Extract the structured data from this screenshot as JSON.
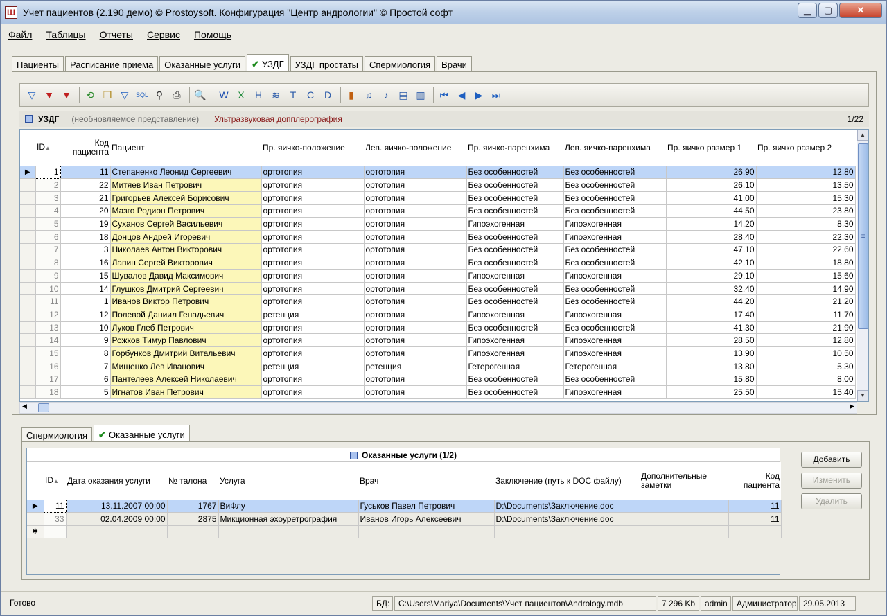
{
  "window": {
    "title": "Учет пациентов (2.190 демо) © Prostoysoft. Конфигурация \"Центр андрологии\" © Простой софт",
    "minimize": "▁",
    "maximize": "▢",
    "close": "✕"
  },
  "menu": [
    "Файл",
    "Таблицы",
    "Отчеты",
    "Сервис",
    "Помощь"
  ],
  "main_tabs": [
    "Пациенты",
    "Расписание приема",
    "Оказанные услуги",
    "УЗДГ",
    "УЗДГ простаты",
    "Спермиология",
    "Врачи"
  ],
  "main_tabs_checked": "✔",
  "toolbar_icons": [
    "filter-icon",
    "filter-add-icon",
    "filter-clear-icon",
    "refresh-icon",
    "copy-icon",
    "filter-edit-icon",
    "sql-icon",
    "find-icon",
    "print-icon",
    "preview-icon",
    "export-word-icon",
    "export-excel-icon",
    "export-html-icon",
    "export-xml-icon",
    "export-text-icon",
    "export-csv-icon",
    "export-dbf-icon",
    "chart-icon",
    "report-icon",
    "report-2-icon",
    "note-icon",
    "note-2-icon",
    "first-record-icon",
    "prev-record-icon",
    "next-record-icon",
    "last-record-icon"
  ],
  "view": {
    "name": "УЗДГ",
    "note": "(необновляемое представление)",
    "description": "Ультразвуковая допплерография",
    "position": "1/22"
  },
  "grid": {
    "columns": [
      "ID",
      "Код пациента",
      "Пациент",
      "Пр. яичко-положение",
      "Лев. яичко-положение",
      "Пр. яичко-паренхима",
      "Лев. яичко-паренхима",
      "Пр. яичко размер 1",
      "Пр. яичко размер 2"
    ],
    "sort_indicator": "▲",
    "current_row_marker": "▶",
    "rows": [
      [
        "1",
        "11",
        "Степаненко Леонид Сергеевич",
        "ортотопия",
        "ортотопия",
        "Без особенностей",
        "Без особенностей",
        "26.90",
        "12.80"
      ],
      [
        "2",
        "22",
        "Митяев Иван Петрович",
        "ортотопия",
        "ортотопия",
        "Без особенностей",
        "Без особенностей",
        "26.10",
        "13.50"
      ],
      [
        "3",
        "21",
        "Григорьев Алексей Борисович",
        "ортотопия",
        "ортотопия",
        "Без особенностей",
        "Без особенностей",
        "41.00",
        "15.30"
      ],
      [
        "4",
        "20",
        "Мазго Родион Петрович",
        "ортотопия",
        "ортотопия",
        "Без особенностей",
        "Без особенностей",
        "44.50",
        "23.80"
      ],
      [
        "5",
        "19",
        "Суханов Сергей Васильевич",
        "ортотопия",
        "ортотопия",
        "Гипоэхогенная",
        "Гипоэхогенная",
        "14.20",
        "8.30"
      ],
      [
        "6",
        "18",
        "Донцов Андрей Игоревич",
        "ортотопия",
        "ортотопия",
        "Без особенностей",
        "Гипоэхогенная",
        "28.40",
        "22.30"
      ],
      [
        "7",
        "3",
        "Николаев Антон Викторович",
        "ортотопия",
        "ортотопия",
        "Без особенностей",
        "Без особенностей",
        "47.10",
        "22.60"
      ],
      [
        "8",
        "16",
        "Лапин Сергей Викторович",
        "ортотопия",
        "ортотопия",
        "Без особенностей",
        "Без особенностей",
        "42.10",
        "18.80"
      ],
      [
        "9",
        "15",
        "Шувалов Давид Максимович",
        "ортотопия",
        "ортотопия",
        "Гипоэхогенная",
        "Гипоэхогенная",
        "29.10",
        "15.60"
      ],
      [
        "10",
        "14",
        "Глушков Дмитрий Сергеевич",
        "ортотопия",
        "ортотопия",
        "Без особенностей",
        "Без особенностей",
        "32.40",
        "14.90"
      ],
      [
        "11",
        "1",
        "Иванов Виктор Петрович",
        "ортотопия",
        "ортотопия",
        "Без особенностей",
        "Без особенностей",
        "44.20",
        "21.20"
      ],
      [
        "12",
        "12",
        "Полевой Даниил Генадьевич",
        "ретенция",
        "ортотопия",
        "Гипоэхогенная",
        "Гипоэхогенная",
        "17.40",
        "11.70"
      ],
      [
        "13",
        "10",
        "Луков Глеб Петрович",
        "ортотопия",
        "ортотопия",
        "Без особенностей",
        "Без особенностей",
        "41.30",
        "21.90"
      ],
      [
        "14",
        "9",
        "Рожков Тимур Павлович",
        "ортотопия",
        "ортотопия",
        "Гипоэхогенная",
        "Гипоэхогенная",
        "28.50",
        "12.80"
      ],
      [
        "15",
        "8",
        "Горбунков Дмитрий Витальевич",
        "ортотопия",
        "ортотопия",
        "Гипоэхогенная",
        "Гипоэхогенная",
        "13.90",
        "10.50"
      ],
      [
        "16",
        "7",
        "Мищенко Лев Иванович",
        "ретенция",
        "ретенция",
        "Гетерогенная",
        "Гетерогенная",
        "13.80",
        "5.30"
      ],
      [
        "17",
        "6",
        "Пантелеев Алексей Николаевич",
        "ортотопия",
        "ортотопия",
        "Без особенностей",
        "Без особенностей",
        "15.80",
        "8.00"
      ],
      [
        "18",
        "5",
        "Игнатов Иван Петрович",
        "ортотопия",
        "ортотопия",
        "Без особенностей",
        "Гипоэхогенная",
        "25.50",
        "15.40"
      ]
    ]
  },
  "bottom_tabs": [
    "Спермиология",
    "Оказанные услуги"
  ],
  "services": {
    "title": "Оказанные услуги (1/2)",
    "columns": [
      "ID",
      "Дата оказания услуги",
      "№ талона",
      "Услуга",
      "Врач",
      "Заключение (путь к DOC файлу)",
      "Дополнительные заметки",
      "Код пациента"
    ],
    "new_row_marker": "✱",
    "rows": [
      [
        "11",
        "13.11.2007 00:00",
        "1767",
        "ВиФлу",
        "Гуськов Павел Петрович",
        "D:\\Documents\\Заключение.doc",
        "",
        "11"
      ],
      [
        "33",
        "02.04.2009 00:00",
        "2875",
        "Микционная эхоуретрография",
        "Иванов Игорь Алексеевич",
        "D:\\Documents\\Заключение.doc",
        "",
        "11"
      ]
    ],
    "buttons": {
      "add": "Добавить",
      "edit": "Изменить",
      "delete": "Удалить"
    }
  },
  "status": {
    "ready": "Готово",
    "db_label": "БД:",
    "db_path": "C:\\Users\\Mariya\\Documents\\Учет пациентов\\Andrology.mdb",
    "size": "7 296 Kb",
    "user": "admin",
    "role": "Администратор",
    "date": "29.05.2013"
  },
  "colors": {
    "selected_row": "#bed6f8",
    "patient_column": "#fcf7b9",
    "check": "#1d8a1d"
  }
}
